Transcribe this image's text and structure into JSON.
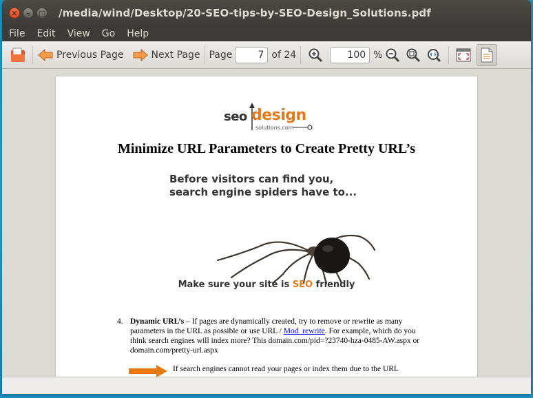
{
  "window": {
    "title": "/media/wind/Desktop/20-SEO-tips-by-SEO-Design_Solutions.pdf"
  },
  "menu": [
    "File",
    "Edit",
    "View",
    "Go",
    "Help"
  ],
  "toolbar": {
    "prev_label": "Previous Page",
    "next_label": "Next Page",
    "page_label": "Page",
    "page_value": "7",
    "page_total": "of 24",
    "zoom_value": "100",
    "zoom_unit": "%"
  },
  "document": {
    "logo": {
      "seo": "seo",
      "design": "design",
      "solutions": "solutions.com"
    },
    "heading": "Minimize URL Parameters to Create Pretty URL’s",
    "banner_line1": "Before visitors can find you,",
    "banner_line2": "search engine spiders have to...",
    "banner_bottom_prefix": "Make sure your site is ",
    "banner_bottom_highlight": "SEO",
    "banner_bottom_suffix": " friendly",
    "item4": {
      "number": "4.",
      "term": "Dynamic URL’s",
      "text_before_link": " – If pages are dynamically created, try to remove or rewrite as many parameters in the URL as possible or use URL / ",
      "link": "Mod_rewrite",
      "text_after_link": ". For example, which do you think search engines will index more? This domain.com/pid=?23740-hza-0485-AW.aspx or domain.com/pretty-url.aspx"
    },
    "item5_text": "If search engines cannot read your pages or index them due to the URL"
  },
  "colors": {
    "accent_orange": "#e07a1f",
    "link_blue": "#0000ee",
    "titlebar": "#3c3b37"
  }
}
